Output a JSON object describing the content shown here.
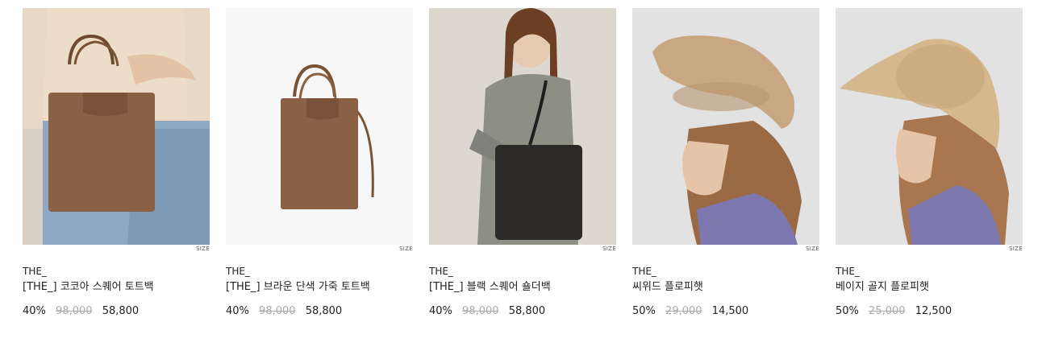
{
  "products": [
    {
      "size_label": "SIZE",
      "brand": "THE_",
      "name": "[THE_] 코코아 스퀘어 토트백",
      "discount": "40%",
      "original_price": "98,000",
      "sale_price": "58,800"
    },
    {
      "size_label": "SIZE",
      "brand": "THE_",
      "name": "[THE_] 브라운 단색 가죽 토트백",
      "discount": "40%",
      "original_price": "98,000",
      "sale_price": "58,800"
    },
    {
      "size_label": "SIZE",
      "brand": "THE_",
      "name": "[THE_] 블랙 스퀘어 숄더백",
      "discount": "40%",
      "original_price": "98,000",
      "sale_price": "58,800"
    },
    {
      "size_label": "SIZE",
      "brand": "THE_",
      "name": "씨위드 플로피햇",
      "discount": "50%",
      "original_price": "29,000",
      "sale_price": "14,500"
    },
    {
      "size_label": "SIZE",
      "brand": "THE_",
      "name": "베이지 골지 플로피햇",
      "discount": "50%",
      "original_price": "25,000",
      "sale_price": "12,500"
    }
  ]
}
